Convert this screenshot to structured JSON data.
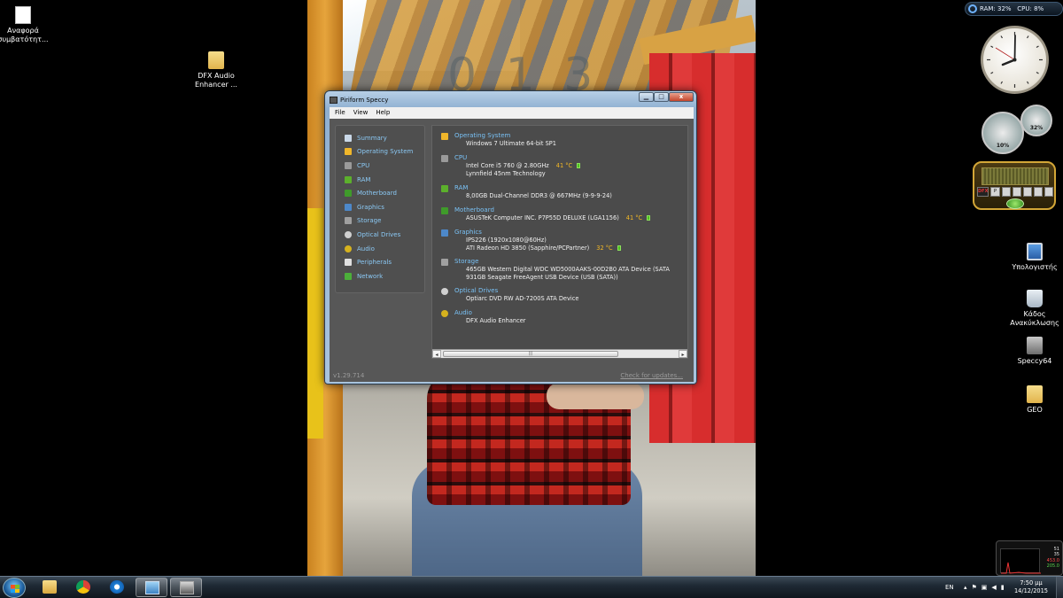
{
  "desktop_icons": [
    {
      "label": "Αναφορά συμβατότητ...",
      "icon": "document-icon"
    },
    {
      "label": "DFX Audio Enhancer ...",
      "icon": "folder-icon"
    },
    {
      "label": "Υπολογιστής",
      "icon": "computer-icon"
    },
    {
      "label": "Κάδος Ανακύκλωσης",
      "icon": "recycle-bin-icon"
    },
    {
      "label": "Speccy64",
      "icon": "speccy-icon"
    },
    {
      "label": "GEO",
      "icon": "folder-icon"
    }
  ],
  "meter_gadget": {
    "ram": "RAM: 32%",
    "cpu": "CPU: 8%"
  },
  "gauge_gadget": {
    "cpu_value": "10%",
    "ram_value": "32%"
  },
  "dfx_gadget": {
    "buttons": [
      "DFX",
      "P",
      "",
      "",
      "",
      "",
      ""
    ]
  },
  "net_gadget": {
    "values": [
      "51",
      "35",
      "453.0",
      "205.0"
    ]
  },
  "speccy": {
    "title": "Piriform Speccy",
    "window_buttons": {
      "minimize": "▁",
      "maximize": "□",
      "close": "x"
    },
    "menu": [
      "File",
      "View",
      "Help"
    ],
    "nav": [
      {
        "label": "Summary",
        "color": "#c9d8e8"
      },
      {
        "label": "Operating System",
        "color": "#f0b62a"
      },
      {
        "label": "CPU",
        "color": "#9a9a9a"
      },
      {
        "label": "RAM",
        "color": "#5cb02c"
      },
      {
        "label": "Motherboard",
        "color": "#3f9b2a"
      },
      {
        "label": "Graphics",
        "color": "#4d88c9"
      },
      {
        "label": "Storage",
        "color": "#a0a0a0"
      },
      {
        "label": "Optical Drives",
        "color": "#d0d0d0"
      },
      {
        "label": "Audio",
        "color": "#d6b21e"
      },
      {
        "label": "Peripherals",
        "color": "#e0e0e0"
      },
      {
        "label": "Network",
        "color": "#4caf3a"
      }
    ],
    "summary": {
      "os": {
        "title": "Operating System",
        "lines": [
          "Windows 7 Ultimate 64-bit SP1"
        ]
      },
      "cpu": {
        "title": "CPU",
        "line1": "Intel Core i5 760 @ 2.80GHz",
        "temp": "41 °C",
        "line2": "Lynnfield 45nm Technology"
      },
      "ram": {
        "title": "RAM",
        "lines": [
          "8,00GB Dual-Channel DDR3 @ 667MHz (9-9-9-24)"
        ]
      },
      "motherboard": {
        "title": "Motherboard",
        "line1": "ASUSTeK Computer INC. P7P55D DELUXE (LGA1156)",
        "temp": "41 °C"
      },
      "graphics": {
        "title": "Graphics",
        "line1": "IPS226 (1920x1080@60Hz)",
        "line2": "ATI Radeon HD 3850 (Sapphire/PCPartner)",
        "temp": "32 °C"
      },
      "storage": {
        "title": "Storage",
        "lines": [
          "465GB Western Digital WDC WD5000AAKS-00D2B0 ATA Device (SATA",
          "931GB Seagate FreeAgent USB Device (USB (SATA))"
        ]
      },
      "optical": {
        "title": "Optical Drives",
        "lines": [
          "Optiarc DVD RW AD-7200S ATA Device"
        ]
      },
      "audio": {
        "title": "Audio",
        "lines": [
          "DFX Audio Enhancer"
        ]
      }
    },
    "version": "v1.29.714",
    "check_updates": "Check for updates..."
  },
  "taskbar": {
    "apps": [
      "explorer-icon",
      "chrome-icon",
      "ie-icon",
      "remote-desktop-icon",
      "speccy-icon"
    ],
    "lang": "EN",
    "time": "7:50 μμ",
    "date": "14/12/2015"
  }
}
